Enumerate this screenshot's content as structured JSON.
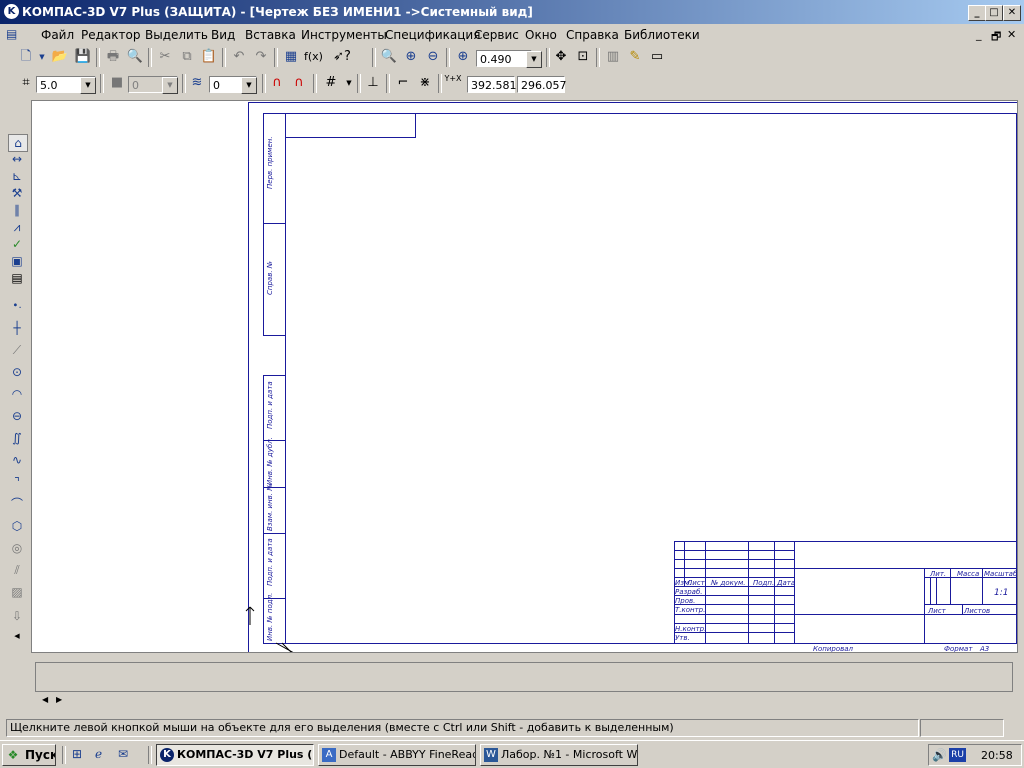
{
  "window": {
    "title": "КОМПАС-3D V7 Plus (ЗАЩИТА) - [Чертеж БЕЗ ИМЕНИ1 ->Системный вид]",
    "controls": {
      "minimize": "_",
      "maximize": "□",
      "close": "✕"
    }
  },
  "menu": {
    "items": [
      "Файл",
      "Редактор",
      "Выделить",
      "Вид",
      "Вставка",
      "Инструменты",
      "Спецификация",
      "Сервис",
      "Окно",
      "Справка",
      "Библиотеки"
    ],
    "mdi_controls": {
      "minimize": "_",
      "restore": "🗗",
      "close": "✕"
    }
  },
  "toolbar_standard": {
    "zoom_value": "0.490"
  },
  "toolbar_current_state": {
    "step_value": "5.0",
    "style_value": "0",
    "layer_value": "0",
    "coord_label": "Y+X",
    "coord_x": "392.581",
    "coord_y": "296.057"
  },
  "drawing": {
    "stamp_column_labels": [
      "Изм.",
      "Лист",
      "№ докум.",
      "Подп.",
      "Дата"
    ],
    "stamp_row_labels": [
      "Разраб.",
      "Пров.",
      "Т.контр.",
      "Н.контр.",
      "Утв."
    ],
    "stamp_right_headers": [
      "Лит.",
      "Масса",
      "Масштаб"
    ],
    "scale_value": "1:1",
    "sheet_label": "Лист",
    "sheets_label": "Листов",
    "copied_label": "Копировал",
    "format_label": "Формат",
    "format_value": "A3",
    "side_labels": [
      "Перв. примен.",
      "Справ. №",
      "Подп. и дата",
      "Инв. № дубл.",
      "Взам. инв. №",
      "Подп. и дата",
      "Инв. № подл."
    ]
  },
  "statusbar": {
    "message": "Щелкните левой кнопкой мыши на объекте для его выделения (вместе с Ctrl или Shift - добавить к выделенным)"
  },
  "taskbar": {
    "start_label": "Пуск",
    "tasks": [
      {
        "label": "КОМПАС-3D V7 Plus (З...",
        "active": true
      },
      {
        "label": "Default - ABBYY FineRead...",
        "active": false
      },
      {
        "label": "Лабор. №1 - Microsoft W...",
        "active": false
      }
    ],
    "lang": "RU",
    "clock": "20:58"
  },
  "colors": {
    "title_start": "#0a246a",
    "title_end": "#a6caf0",
    "drawing_lines": "#1a1a9c"
  }
}
